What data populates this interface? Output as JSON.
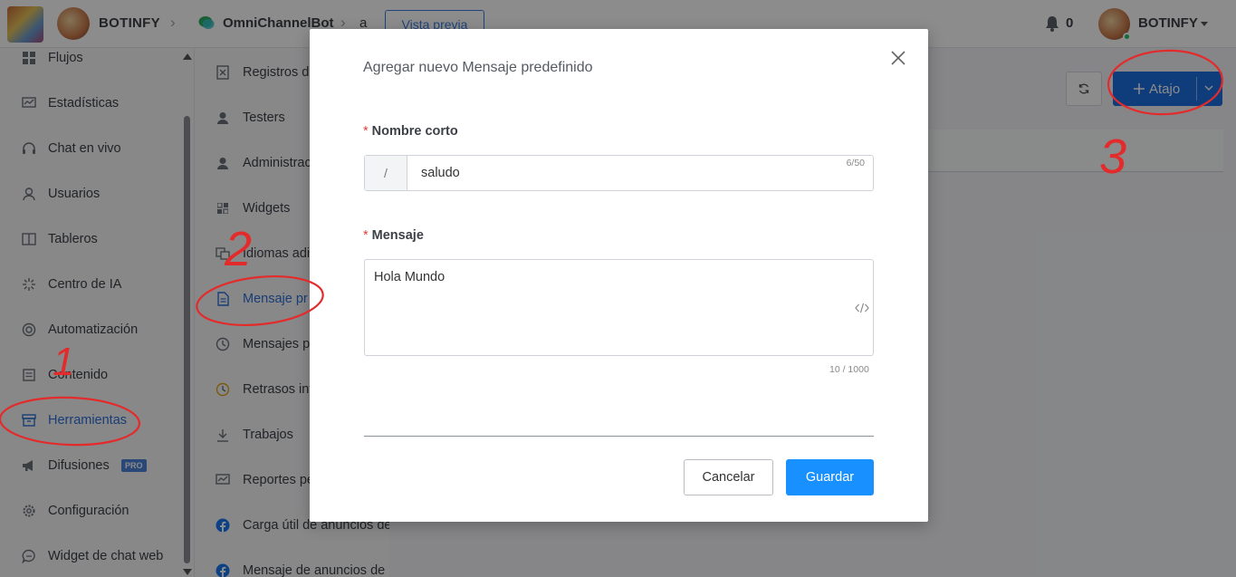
{
  "topbar": {
    "workspace_name": "BOTINFY",
    "bot_name": "OmniChannelBot",
    "crumb_tail": "a",
    "preview_label": "Vista previa",
    "notification_count": "0",
    "user_name": "BOTINFY"
  },
  "sidebar": {
    "items": [
      {
        "label": "Flujos",
        "icon": "grid-icon"
      },
      {
        "label": "Estadísticas",
        "icon": "chart-icon"
      },
      {
        "label": "Chat en vivo",
        "icon": "headset-icon"
      },
      {
        "label": "Usuarios",
        "icon": "user-icon"
      },
      {
        "label": "Tableros",
        "icon": "board-icon"
      },
      {
        "label": "Centro de IA",
        "icon": "sparkle-icon"
      },
      {
        "label": "Automatización",
        "icon": "automation-icon"
      },
      {
        "label": "Contenido",
        "icon": "content-icon"
      },
      {
        "label": "Herramientas",
        "icon": "toolbox-icon",
        "active": true
      },
      {
        "label": "Difusiones",
        "icon": "megaphone-icon",
        "badge": "PRO"
      },
      {
        "label": "Configuración",
        "icon": "gear-icon"
      },
      {
        "label": "Widget de chat web",
        "icon": "chat-bubble-icon"
      }
    ]
  },
  "subnav": {
    "items": [
      {
        "label": "Registros de",
        "icon": "log-icon"
      },
      {
        "label": "Testers",
        "icon": "user-icon"
      },
      {
        "label": "Administrac",
        "icon": "admin-icon"
      },
      {
        "label": "Widgets",
        "icon": "widget-icon"
      },
      {
        "label": "Idiomas adi",
        "icon": "language-icon"
      },
      {
        "label": "Mensaje pr",
        "icon": "document-icon",
        "active": true
      },
      {
        "label": "Mensajes p",
        "icon": "clock-icon"
      },
      {
        "label": "Retrasos int",
        "icon": "clock-icon"
      },
      {
        "label": "Trabajos",
        "icon": "download-icon"
      },
      {
        "label": "Reportes pe",
        "icon": "report-icon"
      },
      {
        "label": "Carga útil de anuncios de",
        "icon": "facebook-icon"
      },
      {
        "label": "Mensaje de anuncios de",
        "icon": "facebook-icon"
      }
    ]
  },
  "main": {
    "add_button_label": "Atajo"
  },
  "modal": {
    "title": "Agregar nuevo Mensaje predefinido",
    "required_mark": "*",
    "short_name": {
      "label": "Nombre corto",
      "prefix": "/",
      "value": "saludo",
      "counter": "6/50"
    },
    "message": {
      "label": "Mensaje",
      "value": "Hola Mundo",
      "counter": "10 / 1000"
    },
    "cancel_label": "Cancelar",
    "save_label": "Guardar"
  },
  "annotations": {
    "step_1": "1",
    "step_2": "2",
    "step_3": "3",
    "color": "#e32b2b"
  },
  "colors": {
    "primary": "#1890ff",
    "active_nav": "#2e6fd6",
    "overlay": "rgba(0,0,0,0.45)"
  }
}
